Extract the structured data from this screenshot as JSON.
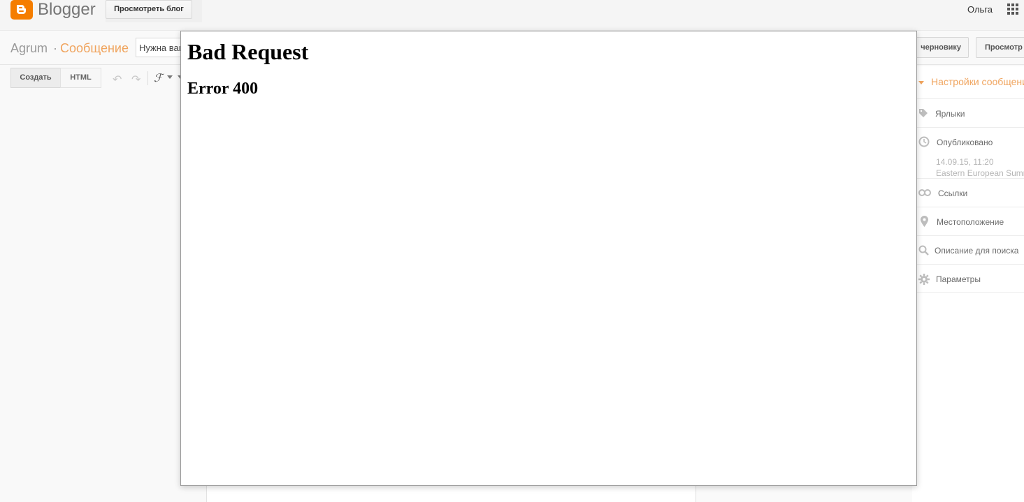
{
  "topbar": {
    "logo_text": "Blogger",
    "view_blog_label": "Просмотреть блог",
    "user_name": "Ольга"
  },
  "header": {
    "blog_name": "Agrum",
    "separator": "·",
    "section_name": "Сообщение",
    "post_title_value": "Нужна ваша",
    "draft_button_label": "черновику",
    "preview_button_label": "Просмотр"
  },
  "toolbar": {
    "compose_tab": "Создать",
    "html_tab": "HTML",
    "font_glyph": "ℱ"
  },
  "sidebar": {
    "header": "Настройки сообщения",
    "items": [
      {
        "label": "Ярлыки"
      },
      {
        "label": "Опубликовано",
        "date": "14.09.15, 11:20",
        "timezone": "Eastern European Summer Time"
      },
      {
        "label": "Ссылки"
      },
      {
        "label": "Местоположение"
      },
      {
        "label": "Описание для поиска"
      },
      {
        "label": "Параметры"
      }
    ]
  },
  "error": {
    "title": "Bad Request",
    "code": "Error 400"
  },
  "colors": {
    "accent": "#f0a45e",
    "blogger_orange": "#f57d00"
  }
}
